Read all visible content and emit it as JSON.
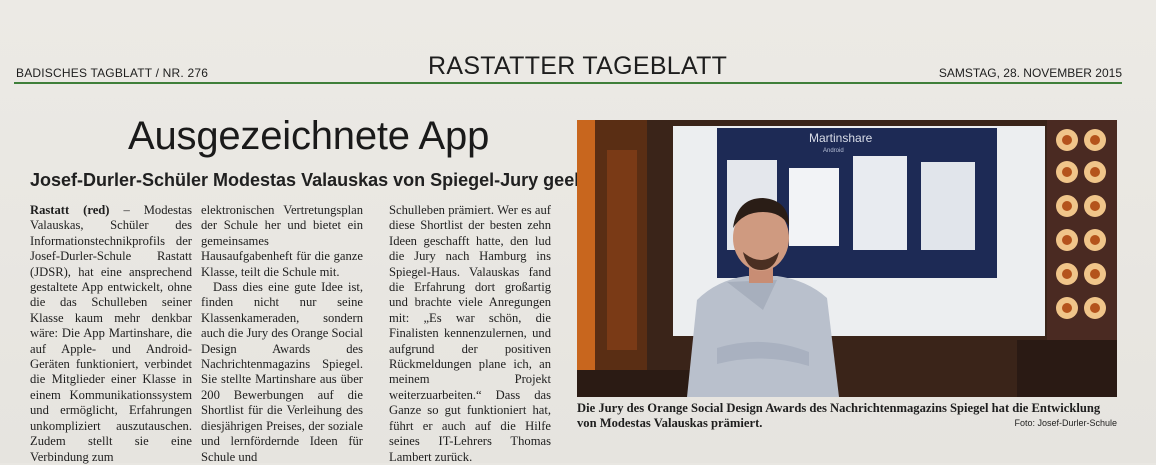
{
  "masthead": {
    "left": "BADISCHES TAGBLATT / NR. 276",
    "center": "RASTATTER TAGEBLATT",
    "right": "SAMSTAG, 28. NOVEMBER 2015"
  },
  "article": {
    "headline": "Ausgezeichnete App",
    "subheadline": "Josef-Durler-Schüler Modestas Valauskas von Spiegel-Jury geehrt",
    "place": "Rastatt (red)",
    "col1": " – Modestas Valauskas, Schüler des Informationstechnikprofils der Josef-Durler-Schule Rastatt (JDSR), hat eine ansprechend gestaltete App entwickelt, ohne die das Schulleben seiner Klasse kaum mehr denkbar wäre: Die App Martinshare, die auf Apple- und Android-Geräten funktioniert, verbindet die Mitglieder einer Klasse in einem Kommunikationssystem und ermöglicht, Erfahrungen unkompliziert auszutauschen. Zudem stellt sie eine Verbindung zum",
    "col2_p1": "elektronischen Vertretungsplan der Schule her und bietet ein gemeinsames Hausaufgabenheft für die ganze Klasse, teilt die Schule mit.",
    "col2_p2": "Dass dies eine gute Idee ist, finden nicht nur seine Klassenkameraden, sondern auch die Jury des Orange Social Design Awards des Nachrichtenmagazins Spiegel. Sie stellte Martinshare aus über 200 Bewerbungen auf die Shortlist für die Verleihung des diesjährigen Preises, der soziale und lernfördernde Ideen für Schule und",
    "col3": "Schulleben prämiert. Wer es auf diese Shortlist der besten zehn Ideen geschafft hatte, den lud die Jury nach Hamburg ins Spiegel-Haus. Valauskas fand die Erfahrung dort großartig und brachte viele Anregungen mit: „Es war schön, die Finalisten kennenzulernen, und aufgrund der positiven Rückmeldungen plane ich, an meinem Projekt weiterzuarbeiten.“ Dass das Ganze so gut funktioniert hat, führt er auch auf die Hilfe seines IT-Lehrers Thomas Lambert zurück."
  },
  "photo": {
    "caption": "Die Jury des Orange Social Design Awards des Nachrichtenmagazins Spiegel hat die Entwicklung von Modestas Valauskas prämiert.",
    "credit": "Foto: Josef-Durler-Schule",
    "screen_title": "Martinshare",
    "screen_sub": "Android"
  }
}
